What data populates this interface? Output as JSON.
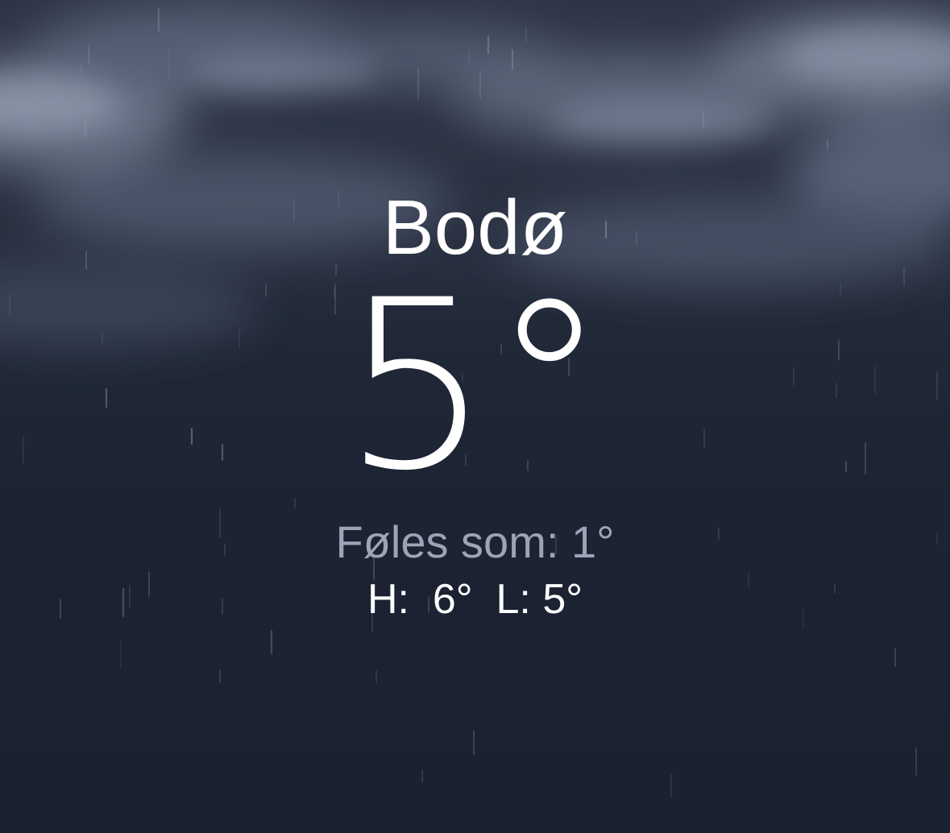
{
  "location": {
    "city": "Bodø"
  },
  "current": {
    "temperature": "5°",
    "feels_like": "Føles som: 1°"
  },
  "range": {
    "high_label": "H:",
    "high_value": "6°",
    "low_label": "L:",
    "low_value": "5°"
  },
  "background": {
    "condition_icon": "rain-clouds-animation",
    "colors": {
      "sky_top": "#2b3242",
      "sky_bottom": "#1a2130",
      "cloud": "#8a93a8",
      "feels_like_text": "#9ea3b6",
      "primary_text": "#ffffff"
    }
  }
}
